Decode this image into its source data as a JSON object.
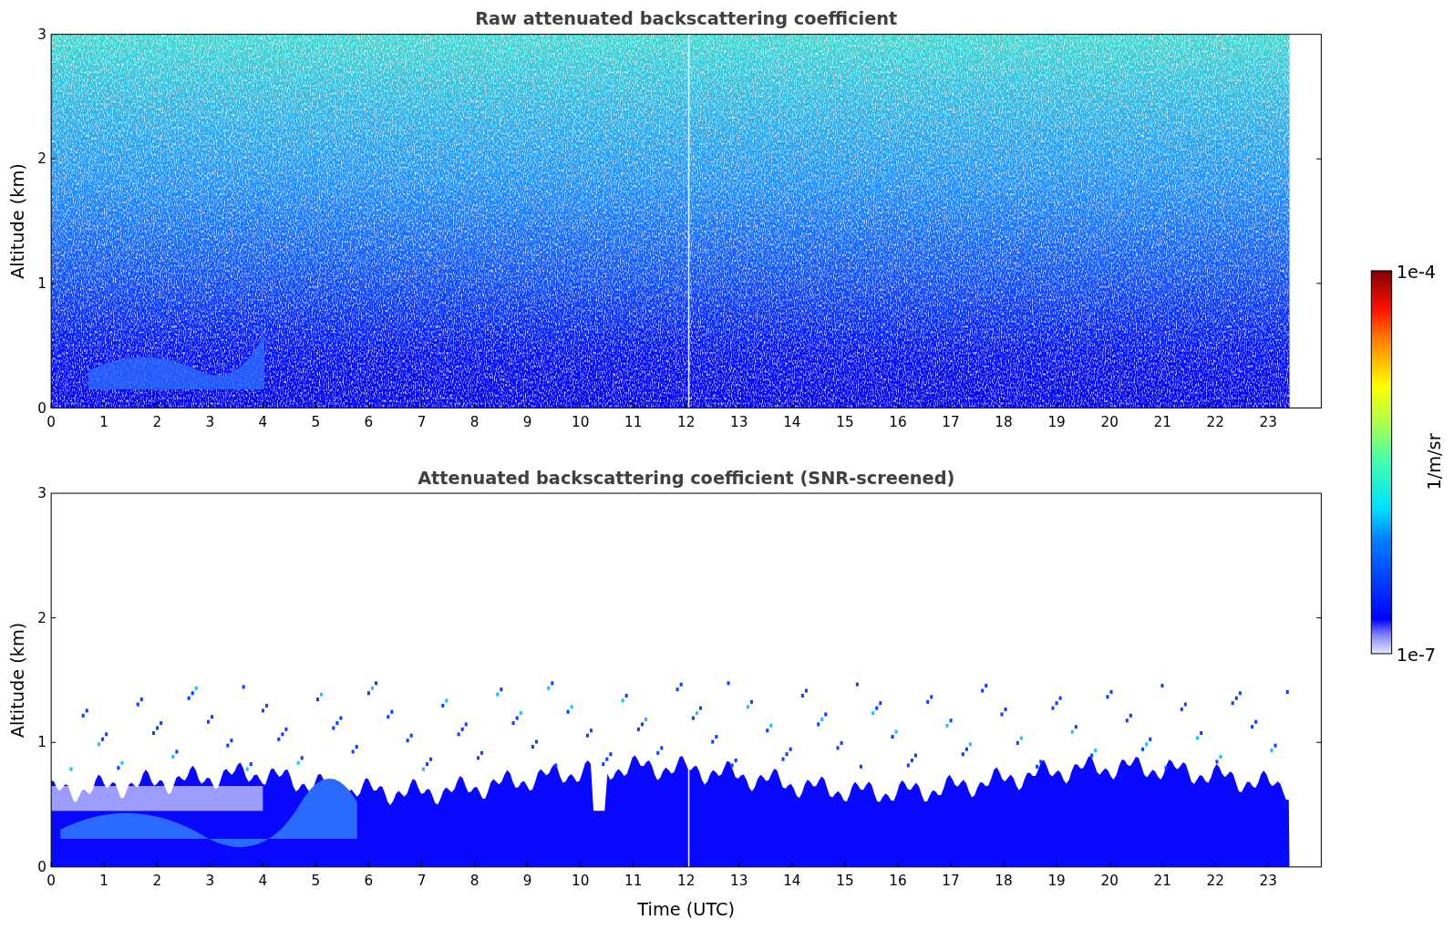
{
  "panels": [
    {
      "title": "Raw attenuated backscattering coefficient",
      "ylabel": "Altitude (km)",
      "screened": false,
      "yticks": [
        "3",
        "2",
        "1",
        "0"
      ],
      "xticks": [
        "0",
        "1",
        "2",
        "3",
        "4",
        "5",
        "6",
        "7",
        "8",
        "9",
        "10",
        "11",
        "12",
        "13",
        "14",
        "15",
        "16",
        "17",
        "18",
        "19",
        "20",
        "21",
        "22",
        "23"
      ]
    },
    {
      "title": "Attenuated backscattering coefficient (SNR-screened)",
      "ylabel": "Altitude (km)",
      "screened": true,
      "yticks": [
        "3",
        "2",
        "1",
        "0"
      ],
      "xticks": [
        "0",
        "1",
        "2",
        "3",
        "4",
        "5",
        "6",
        "7",
        "8",
        "9",
        "10",
        "11",
        "12",
        "13",
        "14",
        "15",
        "16",
        "17",
        "18",
        "19",
        "20",
        "21",
        "22",
        "23"
      ],
      "xlabel": "Time (UTC)"
    }
  ],
  "colorbar": {
    "max_label": "1e-4",
    "min_label": "1e-7",
    "unit": "1/m/sr"
  }
}
